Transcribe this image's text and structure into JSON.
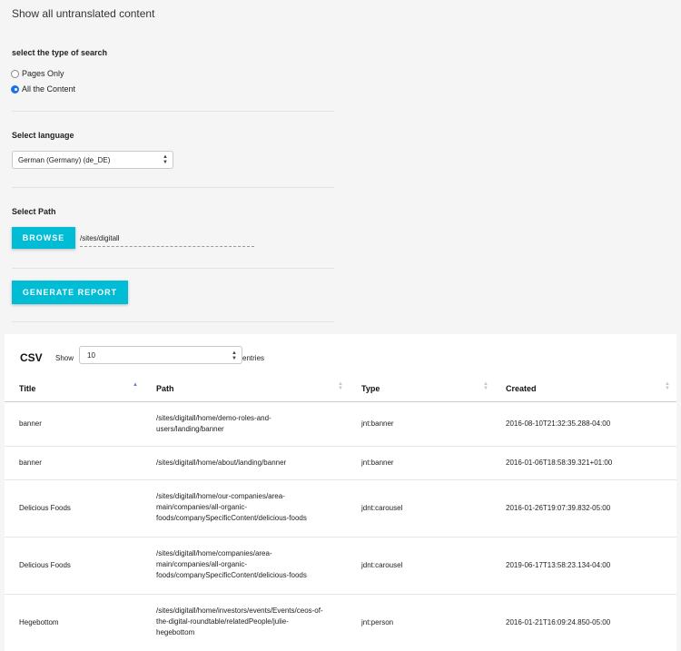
{
  "page": {
    "title": "Show all untranslated content"
  },
  "search_type": {
    "label": "select the type of search",
    "options": [
      {
        "label": "Pages Only",
        "checked": false
      },
      {
        "label": "All the Content",
        "checked": true
      }
    ]
  },
  "language": {
    "label": "Select language",
    "selected": "German (Germany) (de_DE)"
  },
  "path": {
    "label": "Select Path",
    "browse_label": "BROWSE",
    "value": "/sites/digitall"
  },
  "generate_label": "GENERATE REPORT",
  "colors": {
    "accent": "#00bcd4",
    "radio_checked": "#1a73e8",
    "sort_active": "#5b7bd5"
  },
  "results": {
    "csv_label": "CSV",
    "show_label": "Show",
    "entries_value": "10",
    "entries_label": "entries",
    "columns": [
      "Title",
      "Path",
      "Type",
      "Created"
    ],
    "rows": [
      {
        "title": "banner",
        "path": "/sites/digitall/home/demo-roles-and-users/landing/banner",
        "type": "jnt:banner",
        "created": "2016-08-10T21:32:35.288-04:00"
      },
      {
        "title": "banner",
        "path": "/sites/digitall/home/about/landing/banner",
        "type": "jnt:banner",
        "created": "2016-01-06T18:58:39.321+01:00"
      },
      {
        "title": "Delicious Foods",
        "path": "/sites/digitall/home/our-companies/area-main/companies/all-organic-foods/companySpecificContent/delicious-foods",
        "type": "jdnt:carousel",
        "created": "2016-01-26T19:07:39.832-05:00"
      },
      {
        "title": "Delicious Foods",
        "path": "/sites/digitall/home/companies/area-main/companies/all-organic-foods/companySpecificContent/delicious-foods",
        "type": "jdnt:carousel",
        "created": "2019-06-17T13:58:23.134-04:00"
      },
      {
        "title": "Hegebottom",
        "path": "/sites/digitall/home/investors/events/Events/ceos-of-the-digital-roundtable/relatedPeople/julie-hegebottom",
        "type": "jnt:person",
        "created": "2016-01-21T16:09:24.850-05:00"
      }
    ]
  }
}
